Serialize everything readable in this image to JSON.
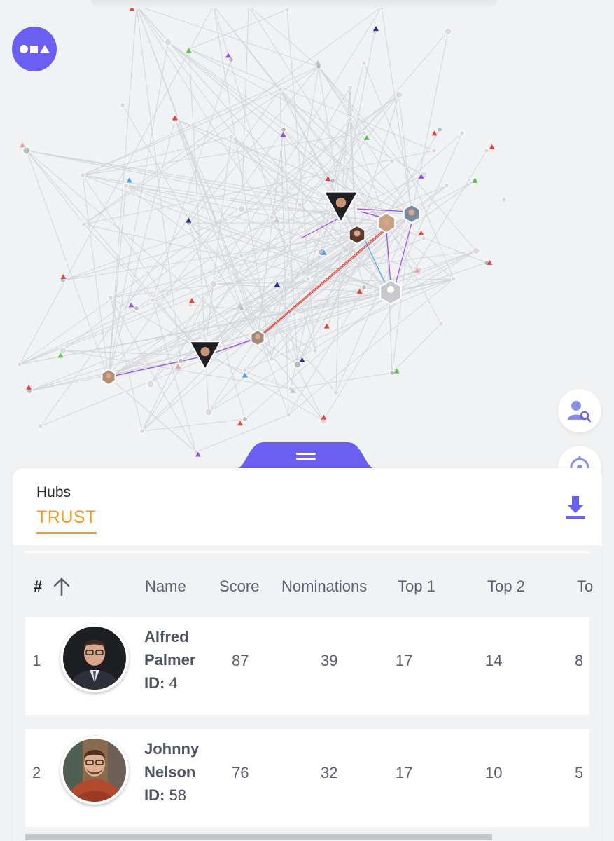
{
  "panel": {
    "section_title": "Hubs",
    "active_tab": "TRUST"
  },
  "table": {
    "headers": {
      "rank": "#",
      "name": "Name",
      "score": "Score",
      "nominations": "Nominations",
      "top1": "Top 1",
      "top2": "Top 2",
      "top3_partial": "To"
    },
    "id_label": "ID:",
    "rows": [
      {
        "rank": "1",
        "first_name": "Alfred",
        "last_name": "Palmer",
        "id": "4",
        "score": "87",
        "nominations": "39",
        "top1": "17",
        "top2": "14",
        "top3": "8"
      },
      {
        "rank": "2",
        "first_name": "Johnny",
        "last_name": "Nelson",
        "id": "58",
        "score": "76",
        "nominations": "32",
        "top1": "17",
        "top2": "10",
        "top3": "5"
      }
    ]
  },
  "icons": {
    "logo": "shapes-logo-icon",
    "search_user": "user-search-icon",
    "target": "target-icon",
    "download": "download-icon",
    "sort": "arrow-up-icon",
    "drawer": "drawer-handle-icon"
  },
  "colors": {
    "accent": "#6a5ff2",
    "tab_active": "#f09a2c",
    "background": "#f1f2f4",
    "edge_red": "#e0463a",
    "edge_purple": "#9b4fe0",
    "edge_blue": "#4aa3e8"
  }
}
